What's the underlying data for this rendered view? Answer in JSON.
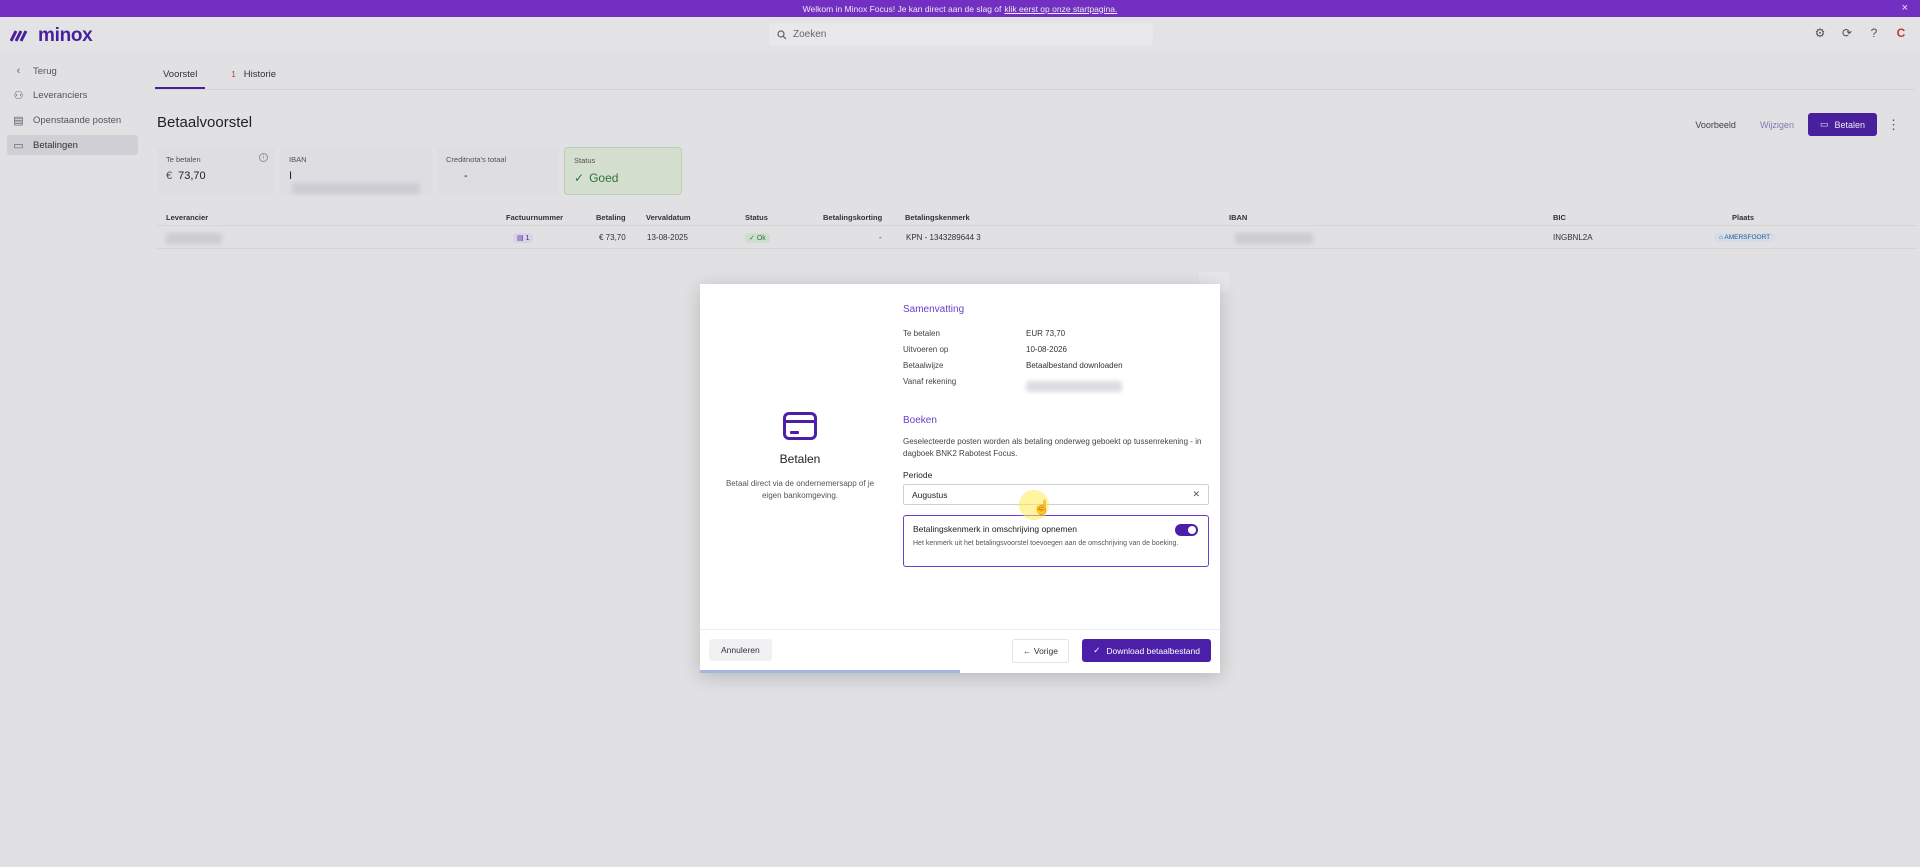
{
  "banner": {
    "text": "Welkom in Minox Focus! Je kan direct aan de slag of",
    "link": "klik eerst op onze startpagina."
  },
  "app": {
    "logo": "minox"
  },
  "search": {
    "placeholder": "Zoeken"
  },
  "topbar": {
    "icons": [
      "settings-icon",
      "sync-icon",
      "help-icon",
      "avatar"
    ],
    "avatar_letter": "C"
  },
  "sidebar": {
    "items": [
      {
        "label": "Terug",
        "icon": "chevron-left-icon"
      },
      {
        "label": "Leveranciers",
        "icon": "users-icon"
      },
      {
        "label": "Openstaande posten",
        "icon": "document-icon"
      },
      {
        "label": "Betalingen",
        "icon": "payment-icon",
        "active": true
      }
    ]
  },
  "tabs": [
    {
      "label": "Voorstel"
    },
    {
      "label": "Historie",
      "count": "1"
    }
  ],
  "page": {
    "title": "Betaalvoorstel"
  },
  "header_buttons": {
    "preview": "Voorbeeld",
    "edit": "Wijzigen",
    "pay": "Betalen"
  },
  "cards": {
    "te_betalen": {
      "label": "Te betalen",
      "currency": "€",
      "value": "73,70"
    },
    "iban": {
      "label": "IBAN",
      "value": "I"
    },
    "creditnotas": {
      "label": "Creditnota's totaal",
      "value": "-"
    },
    "status": {
      "label": "Status",
      "value": "Goed"
    }
  },
  "table": {
    "headers": [
      "Leverancier",
      "Factuurnummer",
      "Betaling",
      "Vervaldatum",
      "Status",
      "Betalingskorting",
      "Betalingskenmerk",
      "IBAN",
      "BIC",
      "Plaats"
    ],
    "row": {
      "factuur": "1",
      "betaling": "€ 73,70",
      "vervaldatum": "13-08-2025",
      "status": "Ok",
      "korting": "-",
      "kenmerk": "KPN - 1343289644 3",
      "bic": "INGBNL2A",
      "plaats": "AMERSFOORT"
    }
  },
  "modal": {
    "left": {
      "title": "Betalen",
      "description": "Betaal direct via de ondernemersapp of je eigen bankomgeving."
    },
    "summary": {
      "title": "Samenvatting",
      "rows": [
        {
          "k": "Te betalen",
          "v": "EUR 73,70"
        },
        {
          "k": "Uitvoeren op",
          "v": "10-08-2026"
        },
        {
          "k": "Betaalwijze",
          "v": "Betaalbestand downloaden"
        },
        {
          "k": "Vanaf rekening",
          "v": ""
        }
      ]
    },
    "booking": {
      "title": "Boeken",
      "description": "Geselecteerde posten worden als betaling onderweg geboekt op tussenrekening - in dagboek BNK2 Rabotest Focus.",
      "period_label": "Periode",
      "period_value": "Augustus"
    },
    "toggle": {
      "title": "Betalingskenmerk in omschrijving opnemen",
      "description": "Het kenmerk uit het betalingsvoorstel toevoegen aan de omschrijving van de boeking.",
      "on": true
    },
    "footer": {
      "cancel": "Annuleren",
      "prev": "Vorige",
      "download": "Download betaalbestand"
    },
    "progress": 0.5
  },
  "colors": {
    "brand": "#4b1fa8",
    "banner": "#7b2fd0",
    "ok": "#2d7a3a"
  }
}
